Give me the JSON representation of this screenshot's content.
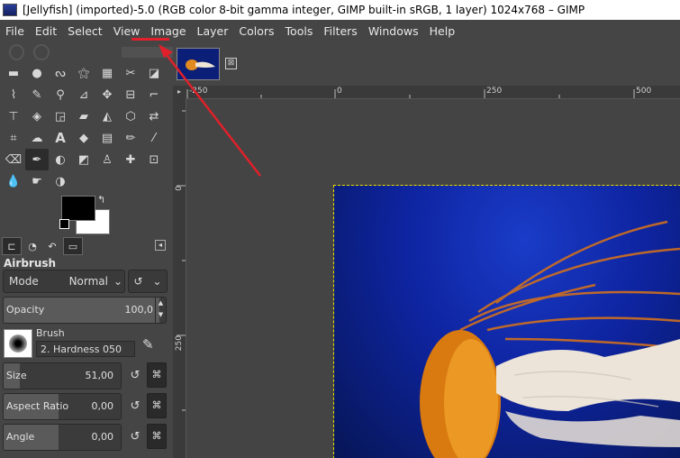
{
  "window": {
    "title": "[Jellyfish] (imported)-5.0 (RGB color 8-bit gamma integer, GIMP built-in sRGB, 1 layer) 1024x768 – GIMP"
  },
  "menubar": {
    "items": [
      "File",
      "Edit",
      "Select",
      "View",
      "Image",
      "Layer",
      "Colors",
      "Tools",
      "Filters",
      "Windows",
      "Help"
    ]
  },
  "annotation": {
    "color": "#e0202a",
    "highlighted_menu": "Image"
  },
  "tool_options": {
    "title": "Airbrush",
    "mode_label": "Mode",
    "mode_value": "Normal",
    "opacity": {
      "label": "Opacity",
      "value": "100,0",
      "fraction": 1.0
    },
    "brush": {
      "label": "Brush",
      "name": "2. Hardness 050"
    },
    "size": {
      "label": "Size",
      "value": "51,00",
      "fraction": 0.1
    },
    "aspect_ratio": {
      "label": "Aspect Ratio",
      "value": "0,00",
      "fraction": 0.5
    },
    "angle": {
      "label": "Angle",
      "value": "0,00",
      "fraction": 0.5
    }
  },
  "colors": {
    "foreground": "#000000",
    "background": "#ffffff"
  },
  "rulers": {
    "horizontal": [
      "-250",
      "0",
      "250",
      "500"
    ],
    "vertical": [
      "0",
      "250"
    ]
  },
  "image_tab": {
    "close_symbol": "⊠"
  }
}
